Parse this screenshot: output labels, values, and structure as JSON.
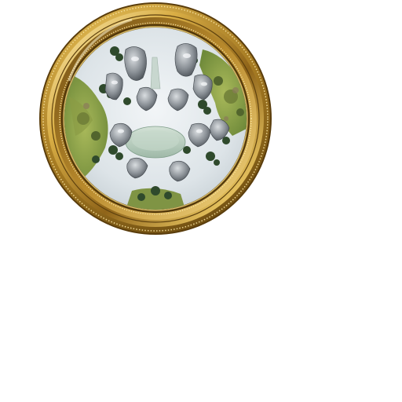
{
  "minimap": {
    "frame_style": "ornate-gold-round",
    "terrain_palette": {
      "snow": "#e4eaee",
      "rock": "#8d9298",
      "grass": "#8ea34e",
      "forest": "#2f4a2c",
      "ice_field": "#b9cdbf",
      "gold_light": "#f3d98a",
      "gold_mid": "#c59a33",
      "gold_dark": "#7a5514"
    },
    "regions": [
      "snow-plateau",
      "west-meadow",
      "east-meadow",
      "central-ice-field",
      "northern-ridges",
      "southern-ridges"
    ]
  }
}
